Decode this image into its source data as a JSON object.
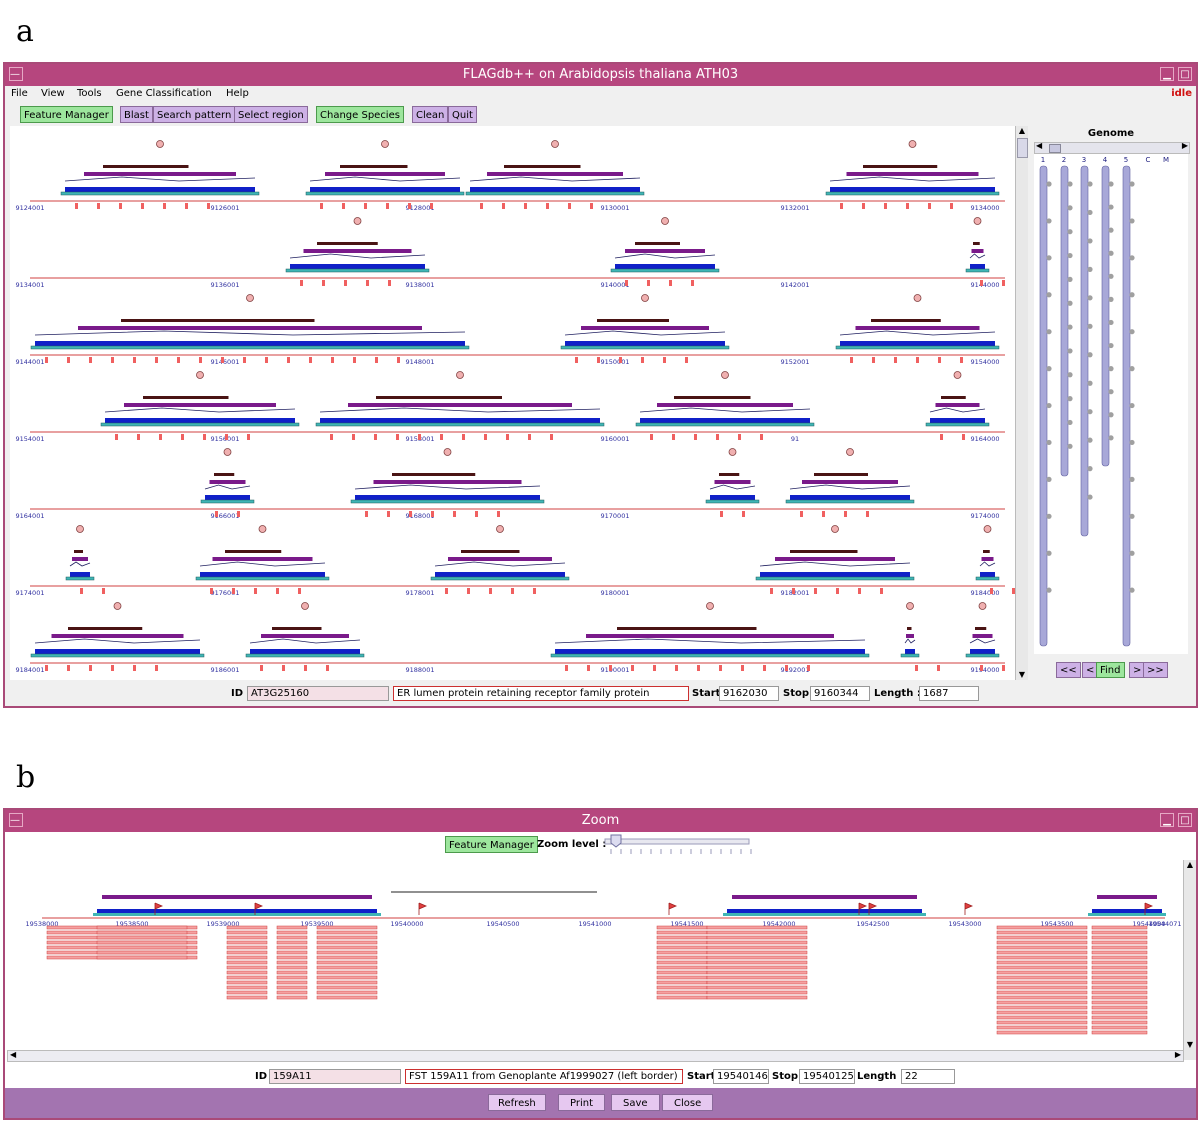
{
  "panels": {
    "a": "a",
    "b": "b"
  },
  "main_window": {
    "title": "FLAGdb++ on Arabidopsis thaliana ATH03",
    "status": "idle",
    "menu": [
      "File",
      "View",
      "Tools",
      "Gene Classification",
      "Help"
    ],
    "toolbar": {
      "feature_manager": "Feature Manager",
      "blast": "Blast",
      "search_pattern": "Search pattern",
      "select_region": "Select region",
      "change_species": "Change Species",
      "clean": "Clean",
      "quit": "Quit"
    },
    "genome_panel": {
      "title": "Genome",
      "chromosomes": [
        "1",
        "2",
        "3",
        "4",
        "5",
        "C",
        "M"
      ],
      "nav": {
        "first": "<<",
        "prev": "<",
        "find": "Find",
        "next": ">",
        "last": ">>"
      }
    },
    "tracks": [
      {
        "ticks": [
          "9124001",
          "9126001",
          "9128001",
          "9130001",
          "9132001",
          "9134000"
        ]
      },
      {
        "ticks": [
          "9134001",
          "9136001",
          "9138001",
          "9140001",
          "9142001",
          "9144000"
        ]
      },
      {
        "ticks": [
          "9144001",
          "9146001",
          "9148001",
          "9150001",
          "9152001",
          "9154000"
        ]
      },
      {
        "ticks": [
          "9154001",
          "9156001",
          "9158001",
          "9160001",
          "91",
          "9164000"
        ]
      },
      {
        "ticks": [
          "9164001",
          "9166001",
          "9168001",
          "9170001",
          "",
          "9174000"
        ]
      },
      {
        "ticks": [
          "9174001",
          "9176001",
          "9178001",
          "9180001",
          "9182001",
          "9184000"
        ]
      },
      {
        "ticks": [
          "9184001",
          "9186001",
          "9188001",
          "9190001",
          "9192001",
          "9194000"
        ]
      }
    ],
    "info": {
      "id_label": "ID",
      "id": "AT3G25160",
      "description": "ER lumen protein retaining receptor family protein",
      "start_label": "Start",
      "start": "9162030",
      "stop_label": "Stop",
      "stop": "9160344",
      "length_label": "Length :",
      "length": "1687"
    }
  },
  "zoom_window": {
    "title": "Zoom",
    "feature_manager": "Feature Manager",
    "zoom_label": "Zoom level :",
    "ticks": [
      "19538000",
      "19538500",
      "19539000",
      "19539500",
      "19540000",
      "19540500",
      "19541000",
      "19541500",
      "19542000",
      "19542500",
      "19543000",
      "19543500",
      "19544000",
      "19544071"
    ],
    "info": {
      "id_label": "ID",
      "id": "159A11",
      "description": "FST 159A11 from Genoplante Af1999027 (left border)",
      "start_label": "Start",
      "start": "19540146",
      "stop_label": "Stop",
      "stop": "19540125",
      "length_label": "Length :",
      "length": "22"
    },
    "buttons": {
      "refresh": "Refresh",
      "print": "Print",
      "save": "Save",
      "close": "Close"
    }
  },
  "colors": {
    "title_bar": "#b6467e",
    "gene_blue": "#1020c8",
    "protein_purple": "#7a1a8a",
    "exon_brown": "#4a1414",
    "mrna_cyan": "#3fb5b5",
    "est_red": "#f06060",
    "axis_red": "#d04040"
  }
}
